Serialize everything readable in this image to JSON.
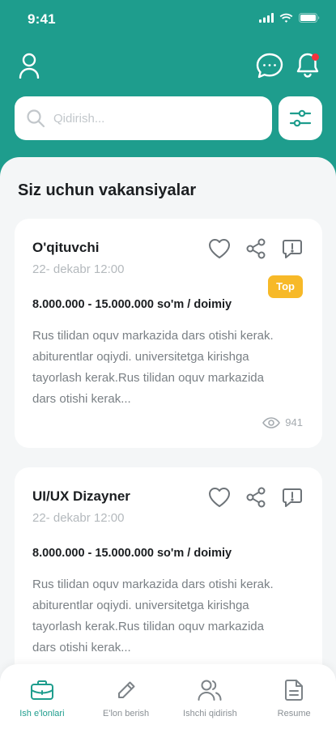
{
  "status": {
    "time": "9:41"
  },
  "search": {
    "placeholder": "Qidirish..."
  },
  "section_title": "Siz uchun vakansiyalar",
  "jobs": [
    {
      "title": "O'qituvchi",
      "date": "22- dekabr 12:00",
      "badge": "Top",
      "salary": "8.000.000 - 15.000.000 so'm / doimiy",
      "description": "Rus tilidan  oquv markazida dars otishi kerak. abiturentlar oqiydi. universitetga kirishga tayorlash kerak.Rus tilidan  oquv markazida dars otishi kerak...",
      "views": "941"
    },
    {
      "title": "UI/UX Dizayner",
      "date": "22- dekabr 12:00",
      "salary": "8.000.000 - 15.000.000 so'm / doimiy",
      "description": "Rus tilidan  oquv markazida dars otishi kerak. abiturentlar oqiydi. universitetga kirishga tayorlash kerak.Rus tilidan  oquv markazida dars otishi kerak..."
    }
  ],
  "nav": [
    {
      "label": "Ish e'lonlari",
      "icon": "briefcase-icon",
      "active": true
    },
    {
      "label": "E'lon berish",
      "icon": "pencil-icon",
      "active": false
    },
    {
      "label": "Ishchi qidirish",
      "icon": "users-icon",
      "active": false
    },
    {
      "label": "Resume",
      "icon": "document-icon",
      "active": false
    }
  ],
  "colors": {
    "primary": "#1e9d8d",
    "badge": "#f7b928",
    "notification_dot": "#f5323d",
    "background": "#f4f6f7"
  }
}
